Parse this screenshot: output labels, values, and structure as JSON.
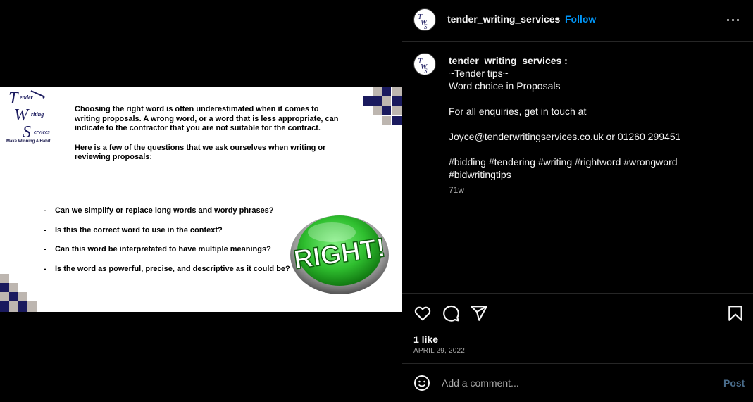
{
  "post": {
    "username": "tender_writing_services",
    "follow_label": "Follow",
    "separator": "•",
    "caption_username": "tender_writing_services :",
    "caption_lines": [
      "~Tender tips~",
      "Word choice in Proposals",
      "",
      "For all enquiries, get in touch at",
      "",
      "Joyce@tenderwritingservices.co.uk or 01260 299451",
      "",
      "#bidding #tendering #writing #rightword #wrongword",
      "#bidwritingtips"
    ],
    "age": "71w",
    "likes": "1 like",
    "date": "APRIL 29, 2022"
  },
  "comment": {
    "placeholder": "Add a comment...",
    "post_label": "Post"
  },
  "slide": {
    "logo_tagline": "Make Winning A Habit",
    "logo_letters": [
      "T",
      "ender",
      "W",
      "riting",
      "S",
      "ervices"
    ],
    "intro_1": "Choosing the right word is often underestimated when it comes to writing proposals. A wrong word, or a word that is less appropriate, can indicate to the contractor that you are not suitable for the contract.",
    "intro_2": "Here is a few of the questions that we ask ourselves when writing or reviewing proposals:",
    "bullets": [
      "Can we simplify or replace long words and wordy phrases?",
      "Is this the correct word to use in the context?",
      "Can this word be interpretated to have multiple meanings?",
      "Is the word as powerful, precise, and descriptive as it could be?"
    ],
    "bullet_marker": "-",
    "button_text": "RIGHT!"
  },
  "icons": {
    "more": "more-options-icon",
    "like": "heart-icon",
    "comment": "comment-icon",
    "share": "share-icon",
    "save": "bookmark-icon",
    "emoji": "emoji-icon"
  },
  "colors": {
    "accent": "#0095f6",
    "background": "#000000",
    "border": "#262626",
    "muted": "#a8a8a8",
    "logo_navy": "#1a1a5e",
    "button_green": "#3cc83c"
  }
}
